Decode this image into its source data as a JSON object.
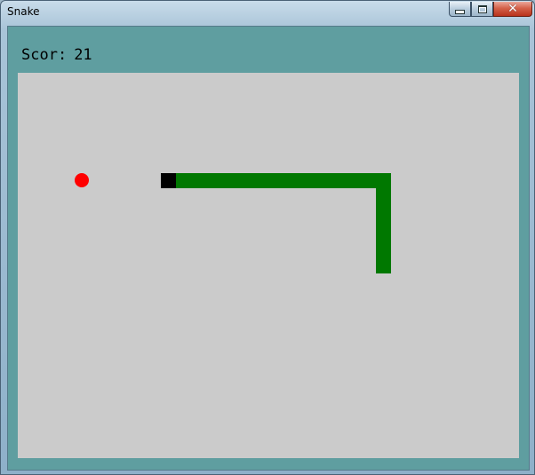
{
  "window": {
    "title": "Snake",
    "controls": {
      "minimize": "minimize",
      "maximize": "maximize",
      "close": "close"
    }
  },
  "score": {
    "label": "Scor:",
    "value": "21"
  },
  "game": {
    "colors": {
      "board": "#cbcbcb",
      "background": "#5f9ea0",
      "snake_body": "#007800",
      "snake_head": "#000000",
      "food": "#ff0000"
    },
    "grid": {
      "cols": 35,
      "rows": 27
    },
    "snake": {
      "head": [
        10,
        7
      ],
      "body": [
        [
          11,
          7
        ],
        [
          12,
          7
        ],
        [
          13,
          7
        ],
        [
          14,
          7
        ],
        [
          15,
          7
        ],
        [
          16,
          7
        ],
        [
          17,
          7
        ],
        [
          18,
          7
        ],
        [
          19,
          7
        ],
        [
          20,
          7
        ],
        [
          21,
          7
        ],
        [
          22,
          7
        ],
        [
          23,
          7
        ],
        [
          24,
          7
        ],
        [
          25,
          7
        ],
        [
          25,
          8
        ],
        [
          25,
          9
        ],
        [
          25,
          10
        ],
        [
          25,
          11
        ],
        [
          25,
          12
        ],
        [
          25,
          13
        ]
      ]
    },
    "food": [
      4,
      7
    ]
  }
}
